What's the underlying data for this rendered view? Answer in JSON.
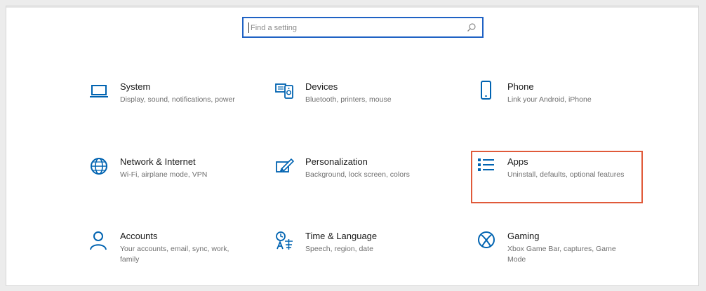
{
  "search": {
    "placeholder": "Find a setting"
  },
  "tiles": [
    {
      "title": "System",
      "description": "Display, sound, notifications, power",
      "icon": "laptop-icon"
    },
    {
      "title": "Devices",
      "description": "Bluetooth, printers, mouse",
      "icon": "devices-icon"
    },
    {
      "title": "Phone",
      "description": "Link your Android, iPhone",
      "icon": "phone-icon"
    },
    {
      "title": "Network & Internet",
      "description": "Wi-Fi, airplane mode, VPN",
      "icon": "globe-icon"
    },
    {
      "title": "Personalization",
      "description": "Background, lock screen, colors",
      "icon": "paintbrush-icon"
    },
    {
      "title": "Apps",
      "description": "Uninstall, defaults, optional features",
      "icon": "apps-list-icon"
    },
    {
      "title": "Accounts",
      "description": "Your accounts, email, sync, work, family",
      "icon": "person-icon"
    },
    {
      "title": "Time & Language",
      "description": "Speech, region, date",
      "icon": "time-language-icon"
    },
    {
      "title": "Gaming",
      "description": "Xbox Game Bar, captures, Game Mode",
      "icon": "xbox-icon"
    }
  ],
  "colors": {
    "accent": "#0063b1",
    "search_border": "#1f62c4",
    "highlight_border": "#e05a3a"
  }
}
